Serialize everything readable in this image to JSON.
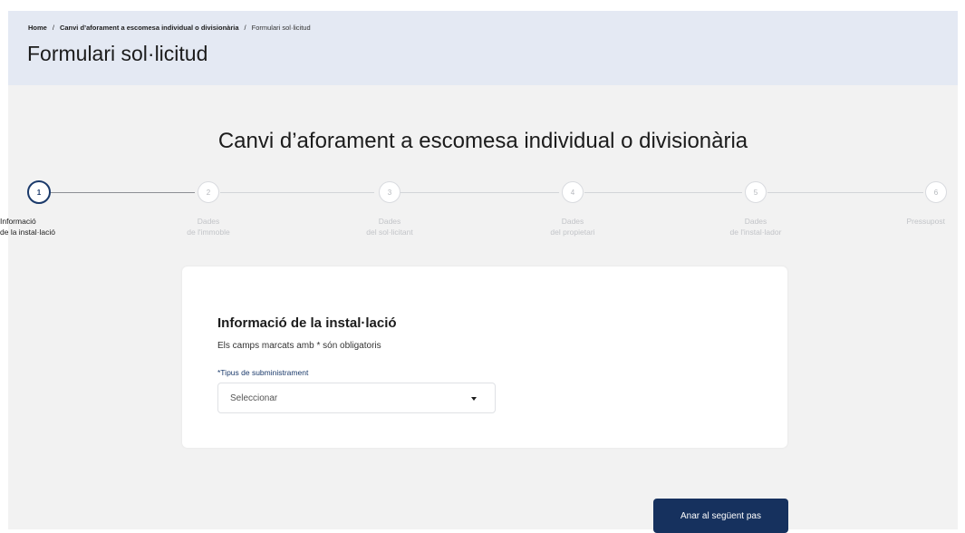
{
  "breadcrumb": {
    "home": "Home",
    "separator": "/",
    "section": "Canvi d’aforament a escomesa individual o divisionària",
    "current": "Formulari sol·licitud"
  },
  "page_title": "Formulari sol·licitud",
  "form_heading": "Canvi d’aforament a escomesa individual o divisionària",
  "stepper": {
    "steps": [
      {
        "number": "1",
        "label_line1": "Informació",
        "label_line2": "de la instal·lació",
        "state": "active"
      },
      {
        "number": "2",
        "label_line1": "Dades",
        "label_line2": "de l'immoble",
        "state": "inactive"
      },
      {
        "number": "3",
        "label_line1": "Dades",
        "label_line2": "del sol·licitant",
        "state": "inactive"
      },
      {
        "number": "4",
        "label_line1": "Dades",
        "label_line2": "del propietari",
        "state": "inactive"
      },
      {
        "number": "5",
        "label_line1": "Dades",
        "label_line2": "de l'instal·lador",
        "state": "inactive"
      },
      {
        "number": "6",
        "label_line1": "Pressupost",
        "label_line2": "",
        "state": "inactive"
      }
    ]
  },
  "section": {
    "title": "Informació de la instal·lació",
    "subtitle": "Els camps marcats amb * són obligatoris",
    "supply_type": {
      "label": "*Tipus de subministrament",
      "value": "Seleccionar"
    }
  },
  "actions": {
    "next_label": "Anar al següent pas"
  },
  "colors": {
    "primary": "#16315e",
    "header_bg": "#e4e9f3",
    "page_bg": "#f2f2f2"
  }
}
